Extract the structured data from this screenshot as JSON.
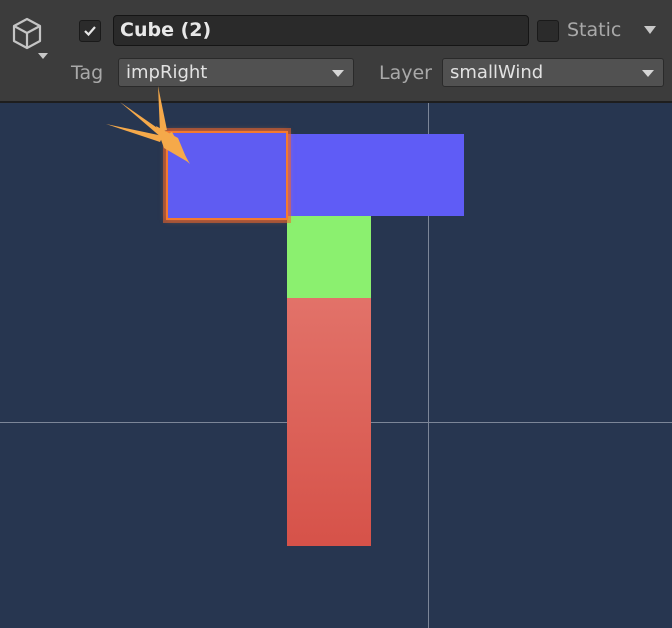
{
  "inspector": {
    "object_icon": "cube-icon",
    "active": true,
    "name": "Cube (2)",
    "static_label": "Static",
    "static_checked": false,
    "tag_label": "Tag",
    "tag_value": "impRight",
    "layer_label": "Layer",
    "layer_value": "smallWind"
  },
  "scene": {
    "objects": [
      {
        "name": "selected-cube",
        "color": "#5f5cf2",
        "selected": true
      },
      {
        "name": "blue-cube",
        "color": "#5f5cf6"
      },
      {
        "name": "green-cube",
        "color": "#8bf06f"
      },
      {
        "name": "red-cube",
        "color": "#d65249"
      }
    ],
    "selection_outline_color": "#f47a2f",
    "pointer_icon": "pointer-arrow-icon",
    "pointer_color": "#f5a94a"
  }
}
